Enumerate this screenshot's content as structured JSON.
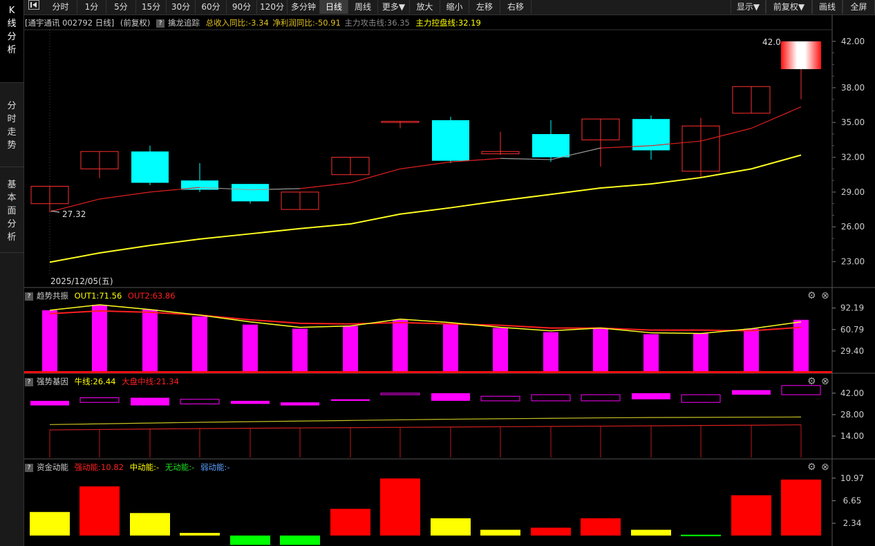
{
  "sidebar": {
    "tabs": [
      {
        "label": "K线分析",
        "chars": [
          "K",
          "线",
          "分",
          "析"
        ],
        "active": true
      },
      {
        "label": "分时走势",
        "chars": [
          "分",
          "时",
          "走",
          "势"
        ],
        "active": false
      },
      {
        "label": "基本面分析",
        "chars": [
          "基",
          "本",
          "面",
          "分",
          "析"
        ],
        "active": false
      }
    ]
  },
  "toolbar": {
    "back_icon": "play-left-icon",
    "buttons": [
      {
        "label": "分时",
        "active": false
      },
      {
        "label": "1分",
        "active": false
      },
      {
        "label": "5分",
        "active": false
      },
      {
        "label": "15分",
        "active": false
      },
      {
        "label": "30分",
        "active": false
      },
      {
        "label": "60分",
        "active": false
      },
      {
        "label": "90分",
        "active": false
      },
      {
        "label": "120分",
        "active": false
      },
      {
        "label": "多分钟",
        "active": false
      },
      {
        "label": "日线",
        "active": true
      },
      {
        "label": "周线",
        "active": false
      },
      {
        "label": "更多▼",
        "active": false
      },
      {
        "label": "放大",
        "active": false
      },
      {
        "label": "缩小",
        "active": false
      },
      {
        "label": "左移",
        "active": false
      },
      {
        "label": "右移",
        "active": false
      }
    ],
    "right_buttons": [
      {
        "label": "显示▼"
      },
      {
        "label": "前复权▼"
      },
      {
        "label": "画线"
      },
      {
        "label": "全屏"
      }
    ]
  },
  "stock_header": {
    "title": "[通宇通讯 002792 日线]",
    "adjust": "(前复权)",
    "indicator": "擒龙追踪",
    "rev_label": "总收入同比:-3.34",
    "profit_label": "净利润同比:-50.91",
    "attack_label": "主力攻击线:36.35",
    "control_label": "主力控盘线:32.19",
    "colors": {
      "title": "#cccccc",
      "rev": "#e0c020",
      "profit": "#e0c020",
      "attack": "#888888",
      "control": "#ffff00"
    }
  },
  "chart_data": [
    {
      "type": "candlestick",
      "name": "main",
      "y_ticks": [
        "42.00",
        "38.00",
        "35.00",
        "32.00",
        "29.00",
        "26.00",
        "23.00"
      ],
      "ylim": [
        22.2,
        43.0
      ],
      "candles": [
        {
          "o": 28.0,
          "c": 29.5,
          "h": 29.5,
          "l": 27.32,
          "color": "red"
        },
        {
          "o": 31.0,
          "c": 32.5,
          "h": 32.5,
          "l": 30.2,
          "color": "red"
        },
        {
          "o": 32.5,
          "c": 29.8,
          "h": 33.0,
          "l": 29.6,
          "color": "cyan"
        },
        {
          "o": 30.0,
          "c": 29.2,
          "h": 31.5,
          "l": 29.0,
          "color": "cyan"
        },
        {
          "o": 29.7,
          "c": 28.2,
          "h": 29.7,
          "l": 28.0,
          "color": "cyan"
        },
        {
          "o": 27.5,
          "c": 29.0,
          "h": 29.0,
          "l": 27.5,
          "color": "red"
        },
        {
          "o": 30.5,
          "c": 32.0,
          "h": 32.0,
          "l": 30.5,
          "color": "red"
        },
        {
          "o": 35.0,
          "c": 35.1,
          "h": 35.1,
          "l": 34.5,
          "color": "red"
        },
        {
          "o": 35.2,
          "c": 31.7,
          "h": 35.5,
          "l": 31.5,
          "color": "cyan"
        },
        {
          "o": 32.3,
          "c": 32.5,
          "h": 34.2,
          "l": 32.2,
          "color": "red"
        },
        {
          "o": 34.0,
          "c": 32.0,
          "h": 35.2,
          "l": 31.6,
          "color": "cyan"
        },
        {
          "o": 33.5,
          "c": 35.3,
          "h": 35.3,
          "l": 31.2,
          "color": "red"
        },
        {
          "o": 35.3,
          "c": 32.6,
          "h": 35.6,
          "l": 31.8,
          "color": "cyan"
        },
        {
          "o": 30.8,
          "c": 34.7,
          "h": 35.4,
          "l": 30.3,
          "color": "red"
        },
        {
          "o": 35.8,
          "c": 38.1,
          "h": 38.1,
          "l": 35.8,
          "color": "red"
        },
        {
          "o": 39.6,
          "c": 42.0,
          "h": 42.0,
          "l": 37.0,
          "color": "limit"
        }
      ],
      "attack_line": [
        27.3,
        28.4,
        29.0,
        29.4,
        29.2,
        29.3,
        29.8,
        31.0,
        31.6,
        31.9,
        31.8,
        32.8,
        33.0,
        33.4,
        34.5,
        36.35
      ],
      "control_line": [
        22.95,
        23.75,
        24.4,
        24.95,
        25.4,
        25.85,
        26.25,
        27.1,
        27.65,
        28.25,
        28.8,
        29.35,
        29.7,
        30.25,
        31.0,
        32.19
      ],
      "annotations": {
        "high_label": "42.00",
        "low_label": "27.32"
      },
      "date_label": "2025/12/05(五)"
    },
    {
      "type": "bar",
      "name": "趋势共振",
      "title": "趋势共振",
      "series_labels": [
        {
          "text": "OUT1:71.56",
          "color": "#ffff00"
        },
        {
          "text": "OUT2:63.86",
          "color": "#ff2020"
        }
      ],
      "y_ticks": [
        "92.19",
        "60.79",
        "29.40"
      ],
      "ylim": [
        0,
        100
      ],
      "bars": [
        89,
        97,
        90,
        80,
        68,
        62,
        66,
        75,
        69,
        63,
        57,
        62,
        54,
        55,
        62,
        75
      ],
      "out1": [
        89,
        97,
        90,
        82,
        72,
        64,
        66,
        76,
        71,
        64,
        59,
        63,
        56,
        55,
        62,
        72
      ],
      "out2": [
        84,
        88,
        86,
        82,
        75,
        70,
        69,
        71,
        69,
        67,
        63,
        63,
        60,
        60,
        59,
        64
      ]
    },
    {
      "type": "bar",
      "name": "强势基因",
      "title": "强势基因",
      "series_labels": [
        {
          "text": "牛线:26.44",
          "color": "#ffff00"
        },
        {
          "text": "大盘中线:21.34",
          "color": "#ff2020"
        }
      ],
      "y_ticks": [
        "42.00",
        "28.00",
        "14.00"
      ],
      "ylim": [
        0,
        46
      ],
      "blocks": [
        {
          "b": 34,
          "t": 37,
          "filled": true
        },
        {
          "b": 36,
          "t": 39,
          "filled": false
        },
        {
          "b": 34,
          "t": 39,
          "filled": true
        },
        {
          "b": 35,
          "t": 38,
          "filled": false
        },
        {
          "b": 35,
          "t": 37,
          "filled": true
        },
        {
          "b": 34,
          "t": 36,
          "filled": true
        },
        {
          "b": 37,
          "t": 38,
          "filled": true
        },
        {
          "b": 41,
          "t": 42,
          "filled": false
        },
        {
          "b": 37,
          "t": 42,
          "filled": true
        },
        {
          "b": 37,
          "t": 40,
          "filled": false
        },
        {
          "b": 37,
          "t": 41,
          "filled": false
        },
        {
          "b": 37,
          "t": 41,
          "filled": false
        },
        {
          "b": 38,
          "t": 42,
          "filled": true
        },
        {
          "b": 36,
          "t": 41,
          "filled": false
        },
        {
          "b": 41,
          "t": 44,
          "filled": true
        },
        {
          "b": 41,
          "t": 47,
          "filled": false
        }
      ],
      "bull_line": [
        21.5,
        22.0,
        22.5,
        23.0,
        23.4,
        23.8,
        24.2,
        24.6,
        25.0,
        25.3,
        25.6,
        25.9,
        26.1,
        26.2,
        26.35,
        26.44
      ],
      "market_line": [
        18.0,
        18.3,
        18.6,
        18.9,
        19.1,
        19.3,
        19.5,
        19.7,
        19.9,
        20.1,
        20.3,
        20.5,
        20.7,
        20.9,
        21.1,
        21.34
      ]
    },
    {
      "type": "bar",
      "name": "资金动能",
      "title": "资金动能",
      "series_labels": [
        {
          "text": "强动能:10.82",
          "color": "#ff2020"
        },
        {
          "text": "中动能:-",
          "color": "#ffff00"
        },
        {
          "text": "无动能:-",
          "color": "#20e020"
        },
        {
          "text": "弱动能:-",
          "color": "#5aa0ff"
        }
      ],
      "y_ticks": [
        "10.97",
        "6.65",
        "2.34"
      ],
      "ylim": [
        -2,
        12
      ],
      "bars": [
        {
          "v": 4.5,
          "color": "yellow"
        },
        {
          "v": 9.4,
          "color": "red"
        },
        {
          "v": 4.3,
          "color": "yellow"
        },
        {
          "v": 0.5,
          "color": "yellow"
        },
        {
          "v": -1.8,
          "color": "green"
        },
        {
          "v": -1.8,
          "color": "green"
        },
        {
          "v": 5.1,
          "color": "red"
        },
        {
          "v": 10.9,
          "color": "red"
        },
        {
          "v": 3.3,
          "color": "yellow"
        },
        {
          "v": 1.1,
          "color": "yellow"
        },
        {
          "v": 1.5,
          "color": "red"
        },
        {
          "v": 3.3,
          "color": "red"
        },
        {
          "v": 1.1,
          "color": "yellow"
        },
        {
          "v": 0.15,
          "color": "green"
        },
        {
          "v": 7.7,
          "color": "red"
        },
        {
          "v": 10.7,
          "color": "red"
        }
      ]
    }
  ]
}
